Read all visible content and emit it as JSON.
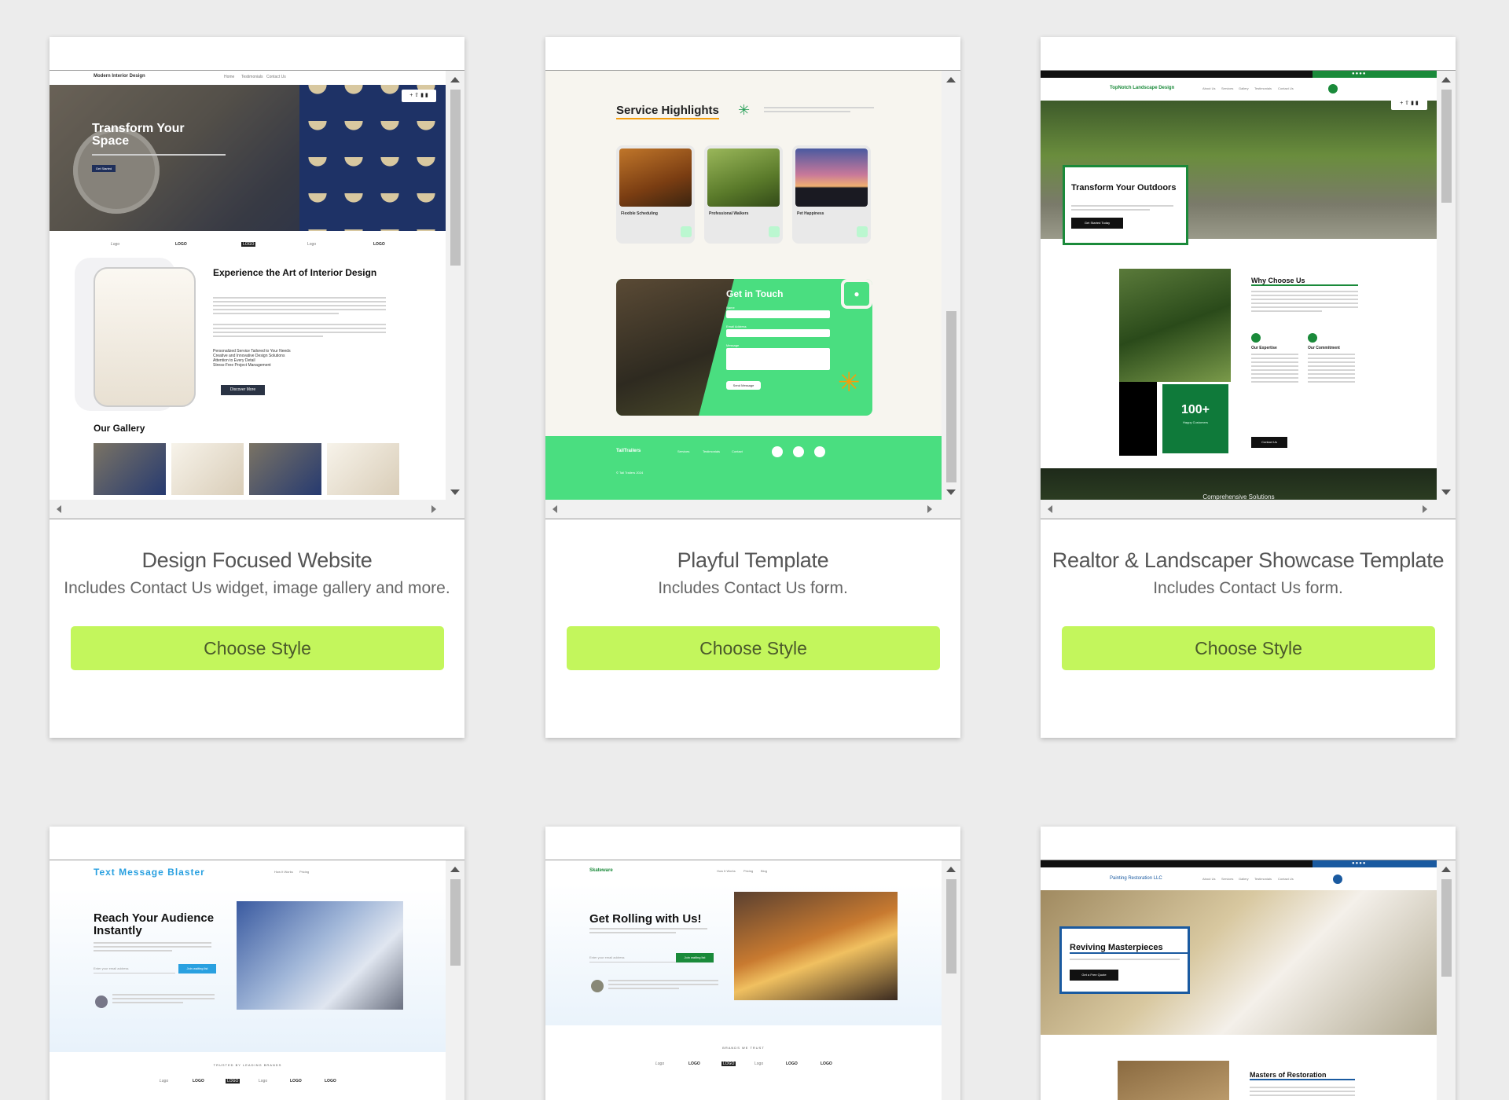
{
  "cards": [
    {
      "title": "Design Focused Website",
      "subtitle": "Includes Contact Us widget, image gallery and more.",
      "button": "Choose Style",
      "preview": {
        "brand": "Modern Interior Design",
        "nav": [
          "Home",
          "Testimonials",
          "Contact Us"
        ],
        "hero_title": "Transform Your Space",
        "hero_button": "Get Started",
        "logos": [
          "Logo",
          "LOGO",
          "LOGO",
          "Logo",
          "LOGO"
        ],
        "section_title": "Experience the Art of Interior Design",
        "bullets": [
          "Personalized Service Tailored to Your Needs",
          "Creative and Innovative Design Solutions",
          "Attention to Every Detail",
          "Stress-Free Project Management"
        ],
        "cta": "Discover More",
        "gallery_title": "Our Gallery"
      }
    },
    {
      "title": "Playful Template",
      "subtitle": "Includes Contact Us form.",
      "button": "Choose Style",
      "preview": {
        "section_title": "Service Highlights",
        "services": [
          "Flexible Scheduling",
          "Professional Walkers",
          "Pet Happiness"
        ],
        "form_title": "Get in Touch",
        "fields": [
          "Name",
          "Email Address",
          "Message"
        ],
        "send": "Send Message",
        "footer_brand": "TailTrailers",
        "footer_links": [
          "Services",
          "Testimonials",
          "Contact"
        ],
        "copyright": "© Tail Trailers 2024"
      }
    },
    {
      "title": "Realtor & Landscaper Showcase Template",
      "subtitle": "Includes Contact Us form.",
      "button": "Choose Style",
      "preview": {
        "brand": "TopNotch Landscape Design",
        "nav": [
          "About Us",
          "Services",
          "Gallery",
          "Testimonials",
          "Contact Us"
        ],
        "hero_title": "Transform Your Outdoors",
        "hero_button": "Get Started Today",
        "section_title": "Why Choose Us",
        "stat": "100+",
        "stat_label": "Happy Customers",
        "features": [
          "Our Expertise",
          "Our Commitment"
        ],
        "cta": "Contact Us",
        "band_title": "Comprehensive Solutions"
      }
    },
    {
      "preview": {
        "brand": "Text Message Blaster",
        "nav": [
          "How It Works",
          "Pricing"
        ],
        "hero_title": "Reach Your Audience Instantly",
        "input_placeholder": "Enter your email address",
        "cta": "Join waiting list",
        "trusted": "TRUSTED BY LEADING BRANDS",
        "logos": [
          "Logo",
          "LOGO",
          "LOGO",
          "Logo",
          "LOGO",
          "LOGO"
        ]
      }
    },
    {
      "preview": {
        "brand": "Skateware",
        "nav": [
          "How It Works",
          "Pricing",
          "Blog"
        ],
        "hero_title": "Get Rolling with Us!",
        "input_placeholder": "Enter your email address",
        "cta": "Join waiting list",
        "trusted": "BRANDS WE TRUST",
        "logos": [
          "Logo",
          "LOGO",
          "LOGO",
          "Logo",
          "LOGO",
          "LOGO"
        ]
      }
    },
    {
      "preview": {
        "brand": "Painting Restoration LLC",
        "nav": [
          "About Us",
          "Services",
          "Gallery",
          "Testimonials",
          "Contact Us"
        ],
        "hero_title": "Reviving Masterpieces",
        "hero_button": "Get a Free Quote",
        "section_title": "Masters of Restoration"
      }
    }
  ],
  "colors": {
    "page_bg": "#ececec",
    "button_bg": "#c3f65c",
    "playful_green": "#4ade80",
    "landscape_green": "#1a8a3a",
    "brand_blue": "#29a0e0"
  }
}
